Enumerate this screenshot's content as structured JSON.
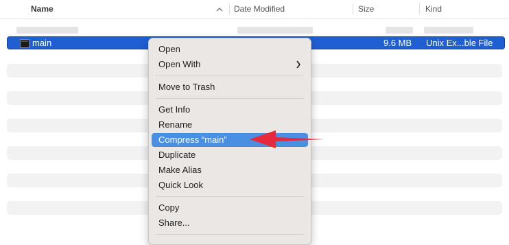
{
  "header": {
    "name": "Name",
    "date_modified": "Date Modified",
    "size": "Size",
    "kind": "Kind",
    "sort_icon": "chevron-up-icon"
  },
  "selected_file": {
    "name": "main",
    "size": "9.6 MB",
    "kind": "Unix Ex...ble File",
    "icon": "terminal-executable-icon"
  },
  "context_menu": {
    "items": [
      {
        "label": "Open"
      },
      {
        "label": "Open With"
      },
      {
        "label": "Move to Trash"
      },
      {
        "label": "Get Info"
      },
      {
        "label": "Rename"
      },
      {
        "label": "Compress “main”"
      },
      {
        "label": "Duplicate"
      },
      {
        "label": "Make Alias"
      },
      {
        "label": "Quick Look"
      },
      {
        "label": "Copy"
      },
      {
        "label": "Share..."
      }
    ],
    "highlighted": "Compress “main”"
  },
  "colors": {
    "selection": "#1f5fd2",
    "menu_highlight": "#4a90e2",
    "annotation_arrow": "#e8283c"
  }
}
